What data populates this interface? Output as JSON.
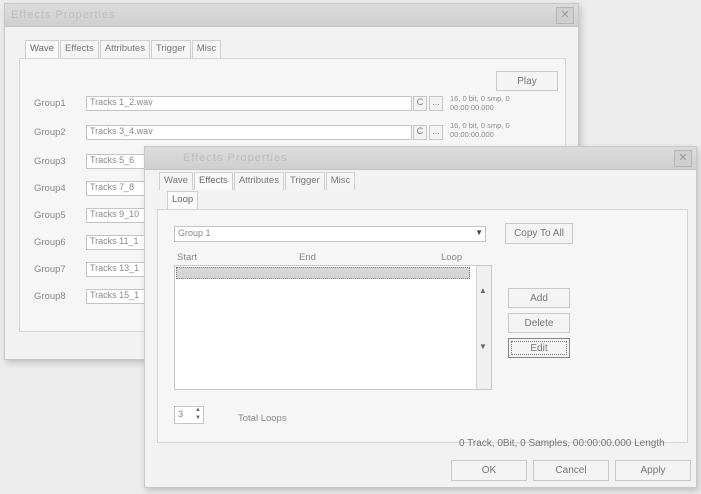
{
  "back_window": {
    "title": "Effects Properties",
    "tabs": [
      "Wave",
      "Effects",
      "Attributes",
      "Trigger",
      "Misc"
    ],
    "play_label": "Play",
    "rows": [
      {
        "group": "Group1",
        "track": "Tracks 1_2.wav",
        "c": "C",
        "dots": "...",
        "info1": "16, 0 bit, 0 smp, 0",
        "info2": "00:00:00.000"
      },
      {
        "group": "Group2",
        "track": "Tracks 3_4.wav",
        "c": "C",
        "dots": "...",
        "info1": "16, 0 bit, 0 smp, 0",
        "info2": "00:00:00.000"
      },
      {
        "group": "Group3",
        "track": "Tracks 5_6"
      },
      {
        "group": "Group4",
        "track": "Tracks 7_8"
      },
      {
        "group": "Group5",
        "track": "Tracks 9_10"
      },
      {
        "group": "Group6",
        "track": "Tracks 11_1"
      },
      {
        "group": "Group7",
        "track": "Tracks 13_1"
      },
      {
        "group": "Group8",
        "track": "Tracks 15_1"
      }
    ]
  },
  "front_window": {
    "title": "Effects Properties",
    "tabs": [
      "Wave",
      "Effects",
      "Attributes",
      "Trigger",
      "Misc"
    ],
    "subtab": "Loop",
    "group_select": "Group 1",
    "copy_to_all": "Copy To All",
    "columns": [
      "Start",
      "End",
      "Loop"
    ],
    "buttons": {
      "add": "Add",
      "delete": "Delete",
      "edit": "Edit"
    },
    "total_loops_value": "3",
    "total_loops_label": "Total Loops",
    "status": "0 Track, 0Bit, 0 Samples, 00:00:00.000 Length",
    "ok": "OK",
    "cancel": "Cancel",
    "apply": "Apply"
  }
}
